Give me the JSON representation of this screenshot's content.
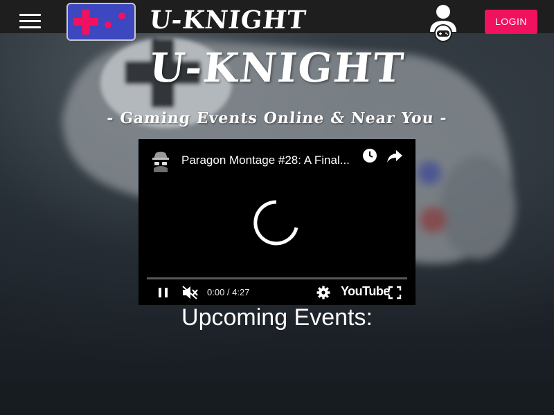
{
  "header": {
    "brand": "U-KNIGHT",
    "login_label": "LOGIN"
  },
  "hero": {
    "title": "U-KNIGHT",
    "subtitle": "- Gaming Events Online & Near You -"
  },
  "video": {
    "title": "Paragon Montage #28: A Final...",
    "time": "0:00 / 4:27",
    "youtube_label": "YouTube"
  },
  "events": {
    "heading": "Upcoming Events:"
  },
  "colors": {
    "accent": "#f0125f",
    "logo_bg": "#3c47c0",
    "navbar_bg": "#1e1e1e"
  }
}
